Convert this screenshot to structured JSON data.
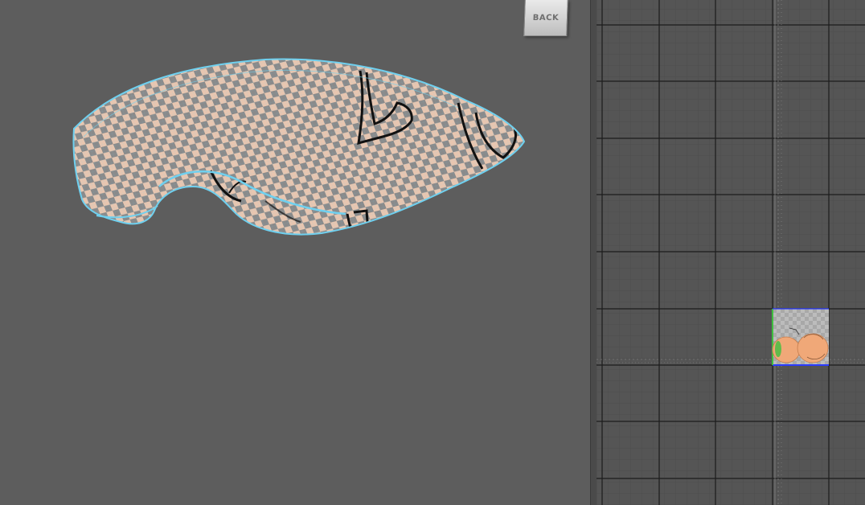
{
  "viewport": {
    "viewcube": {
      "face_label": "BACK",
      "icon": "viewcube-icon"
    },
    "mesh": {
      "icon": "uv-checker-mesh",
      "texture_colors": {
        "dark": "#8a8a8a",
        "light": "#e8c6b0",
        "wireframe": "#6fd0ef",
        "outline": "#111111"
      }
    }
  },
  "uv_editor": {
    "colors": {
      "background": "#555555",
      "grid_line": "#1c1c1c",
      "fine_grid": "#4d4d4d",
      "uv_tile": "#b8b8b8",
      "uv_shell": "#f0a878",
      "axis_u": "#2a3bff",
      "axis_v": "#3fbf3f"
    }
  }
}
